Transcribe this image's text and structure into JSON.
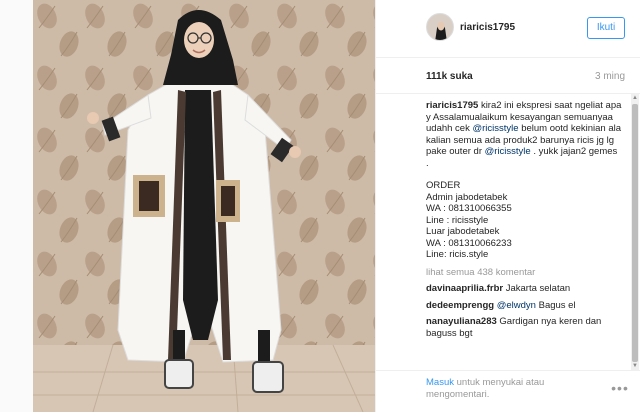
{
  "post": {
    "username": "riaricis1795",
    "follow_label": "Ikuti",
    "likes": "111k suka",
    "time": "3 ming"
  },
  "caption": {
    "username": "riaricis1795",
    "line1": "kira2 ini ekspresi saat ngeliat apa y  Assalamualaikum kesayangan semuanyaa  udahh cek",
    "mention1": "@ricisstyle",
    "line2": "belum ootd kekinian ala kalian semua ada produk2 barunya  ricis jg lg pake outer dr",
    "mention2": "@ricisstyle",
    "line3": ". yukk jajan2 gemes .",
    "order": [
      "ORDER ",
      "Admin jabodetabek",
      "WA : 081310066355",
      "Line : ricisstyle",
      "Luar jabodetabek",
      "WA : 081310066233",
      "Line: ricis.style"
    ]
  },
  "view_all": "lihat semua 438 komentar",
  "comments": [
    {
      "user": "davinaaprilia.frbr",
      "text": "Jakarta selatan"
    },
    {
      "user": "dedeemprengg",
      "mention": "@elwdyn",
      "text": "Bagus el"
    },
    {
      "user": "nanayuliana283",
      "text": "Gardigan nya keren dan baguss bgt"
    }
  ],
  "footer": {
    "login_link": "Masuk",
    "login_text": "untuk menyukai atau mengomentari."
  },
  "colors": {
    "accent": "#3897f0",
    "muted": "#999999",
    "mention": "#003569"
  },
  "icons": [
    "more-options-icon",
    "scroll-up-arrow-icon",
    "scroll-down-arrow-icon"
  ]
}
